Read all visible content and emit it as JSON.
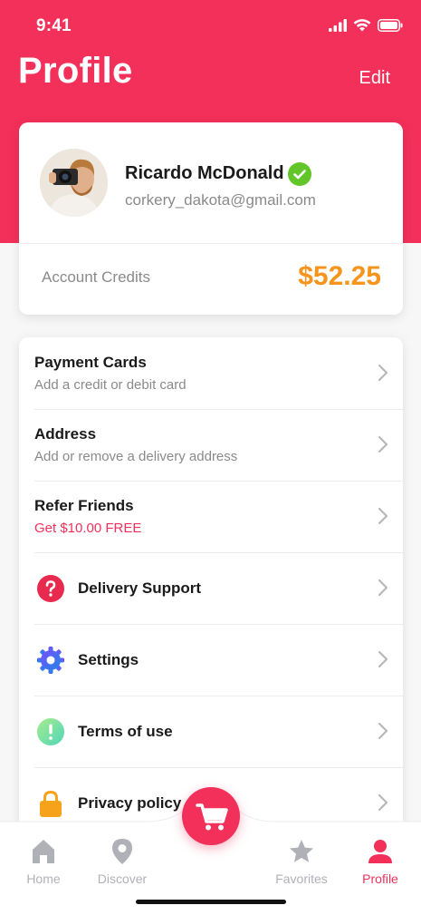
{
  "status_bar": {
    "time": "9:41"
  },
  "header": {
    "title": "Profile",
    "edit_label": "Edit"
  },
  "profile": {
    "name": "Ricardo McDonald",
    "email": "corkery_dakota@gmail.com",
    "verified": true,
    "credits_label": "Account Credits",
    "credits_value": "$52.25"
  },
  "menu": {
    "payment": {
      "title": "Payment Cards",
      "subtitle": "Add a credit or debit card"
    },
    "address": {
      "title": "Address",
      "subtitle": "Add or remove a delivery address"
    },
    "refer": {
      "title": "Refer Friends",
      "subtitle": "Get $10.00 FREE"
    },
    "support": {
      "label": "Delivery Support",
      "icon": "question-icon"
    },
    "settings": {
      "label": "Settings",
      "icon": "gear-icon"
    },
    "terms": {
      "label": "Terms of use",
      "icon": "exclamation-icon"
    },
    "privacy": {
      "label": "Privacy policy",
      "icon": "lock-icon"
    }
  },
  "tabs": {
    "home": "Home",
    "discover": "Discover",
    "favorites": "Favorites",
    "profile": "Profile",
    "active": "profile"
  },
  "colors": {
    "brand": "#f2305a",
    "credits": "#f7941d",
    "verified": "#62c62b",
    "inactive_tab": "#b0b0b8"
  }
}
